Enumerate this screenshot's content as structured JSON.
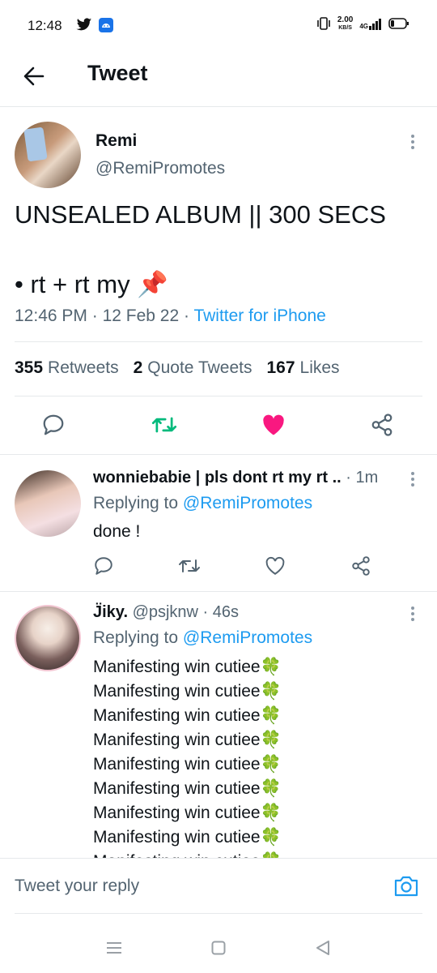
{
  "status_bar": {
    "time": "12:48",
    "speed_value": "2.00",
    "speed_unit": "KB/S",
    "network": "4G"
  },
  "header": {
    "title": "Tweet"
  },
  "main_tweet": {
    "display_name": "Remi",
    "handle": "@RemiPromotes",
    "text_line1": "UNSEALED ALBUM || 300 SECS",
    "text_line2": "• rt + rt my 📌",
    "time": "12:46 PM",
    "date": "12 Feb 22",
    "source": "Twitter for iPhone",
    "stats": {
      "retweets_count": "355",
      "retweets_label": "Retweets",
      "quotes_count": "2",
      "quotes_label": "Quote Tweets",
      "likes_count": "167",
      "likes_label": "Likes"
    }
  },
  "replies": [
    {
      "display_name": "wonniebabie | pls dont rt my rt ..",
      "time": "1m",
      "replying_prefix": "Replying to",
      "replying_to": "@RemiPromotes",
      "text": "done !"
    },
    {
      "display_name": "J̈iky.",
      "handle": "@psjknw",
      "time": "46s",
      "replying_prefix": "Replying to",
      "replying_to": "@RemiPromotes",
      "lines": [
        "Manifesting win cutiee🍀",
        "Manifesting win cutiee🍀",
        "Manifesting win cutiee🍀",
        "Manifesting win cutiee🍀",
        "Manifesting win cutiee🍀",
        "Manifesting win cutiee🍀",
        "Manifesting win cutiee🍀",
        "Manifesting win cutiee🍀",
        "Manifesting win cutiee🍀"
      ]
    }
  ],
  "compose": {
    "placeholder": "Tweet your reply"
  },
  "colors": {
    "accent": "#1d9bf0",
    "retweet": "#00ba7c",
    "like": "#f91880",
    "muted": "#536471"
  }
}
